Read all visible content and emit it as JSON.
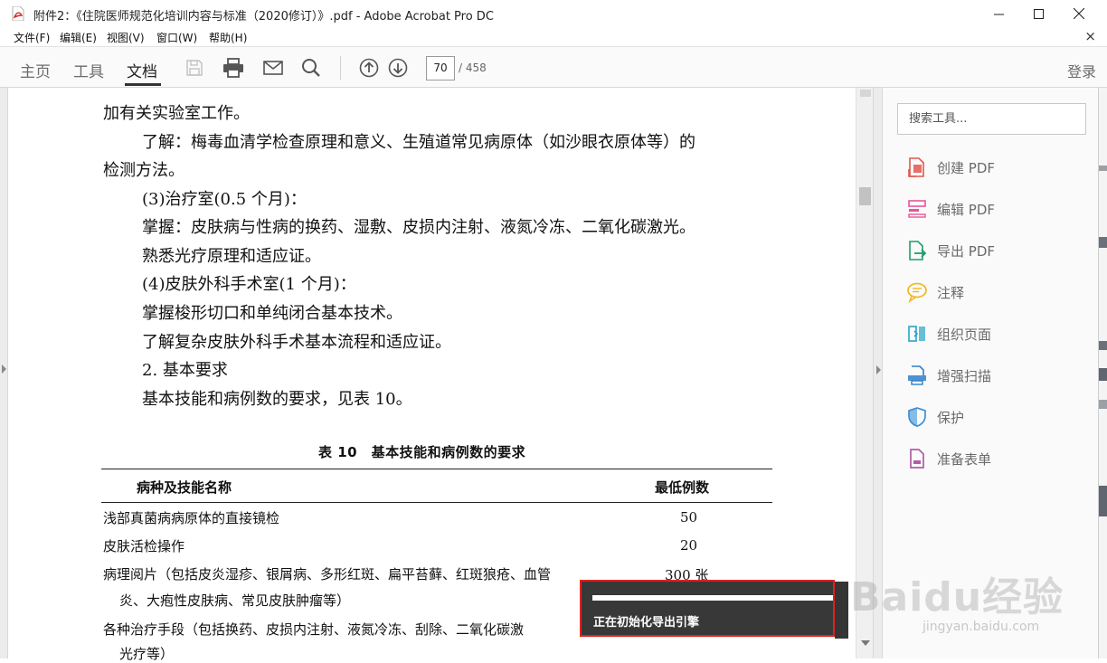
{
  "window": {
    "title": "附件2：《住院医师规范化培训内容与标准（2020修订）》.pdf - Adobe Acrobat Pro DC"
  },
  "menubar": {
    "items": [
      "文件(F)",
      "编辑(E)",
      "视图(V)",
      "窗口(W)",
      "帮助(H)"
    ],
    "close_glyph": "×"
  },
  "toolbar": {
    "tabs": [
      "主页",
      "工具",
      "文档"
    ],
    "active_tab": "文档",
    "page_number": "70",
    "page_total": "/ 458",
    "login_label": "登录"
  },
  "document": {
    "lines": [
      "加有关实验室工作。",
      "了解：梅毒血清学检查原理和意义、生殖道常见病原体（如沙眼衣原体等）的",
      "检测方法。",
      "(3)治疗室(0.5 个月)：",
      "掌握：皮肤病与性病的换药、湿敷、皮损内注射、液氮冷冻、二氧化碳激光。",
      "熟悉光疗原理和适应证。",
      "(4)皮肤外科手术室(1 个月)：",
      "掌握梭形切口和单纯闭合基本技术。",
      "了解复杂皮肤外科手术基本流程和适应证。",
      "2. 基本要求",
      "基本技能和病例数的要求，见表 10。"
    ],
    "table": {
      "title": "表 10　基本技能和病例数的要求",
      "headers": [
        "病种及技能名称",
        "最低例数"
      ],
      "rows": [
        [
          "浅部真菌病病原体的直接镜检",
          "50"
        ],
        [
          "皮肤活检操作",
          "20"
        ],
        [
          "病理阅片（包括皮炎湿疹、银屑病、多形红斑、扁平苔藓、红斑狼疮、血管",
          "300 张"
        ],
        [
          "炎、大疱性皮肤病、常见皮肤肿瘤等）",
          ""
        ],
        [
          "各种治疗手段（包括换药、皮损内注射、液氮冷冻、刮除、二氧化碳激",
          ""
        ],
        [
          "光疗等）",
          ""
        ]
      ]
    }
  },
  "tools_pane": {
    "search_placeholder": "搜索工具...",
    "items": [
      {
        "label": "创建 PDF",
        "icon": "create-pdf-icon",
        "color": "#e2574c"
      },
      {
        "label": "编辑 PDF",
        "icon": "edit-pdf-icon",
        "color": "#e8559a"
      },
      {
        "label": "导出 PDF",
        "icon": "export-pdf-icon",
        "color": "#1e9e6a"
      },
      {
        "label": "注释",
        "icon": "comment-icon",
        "color": "#f2b829"
      },
      {
        "label": "组织页面",
        "icon": "organize-pages-icon",
        "color": "#2aa3c8"
      },
      {
        "label": "增强扫描",
        "icon": "enhance-scan-icon",
        "color": "#2f7fc9"
      },
      {
        "label": "保护",
        "icon": "protect-icon",
        "color": "#3b8fd6"
      },
      {
        "label": "准备表单",
        "icon": "prepare-form-icon",
        "color": "#b15ca8"
      }
    ]
  },
  "toast": {
    "message": "正在初始化导出引擎",
    "progress": 1.0
  },
  "watermark": {
    "brand": "Baidu经验",
    "sub": "jingyan.baidu.com"
  },
  "colors": {
    "toast_bg": "#383838",
    "toast_border": "#e02020",
    "accent_red": "#e02020"
  }
}
